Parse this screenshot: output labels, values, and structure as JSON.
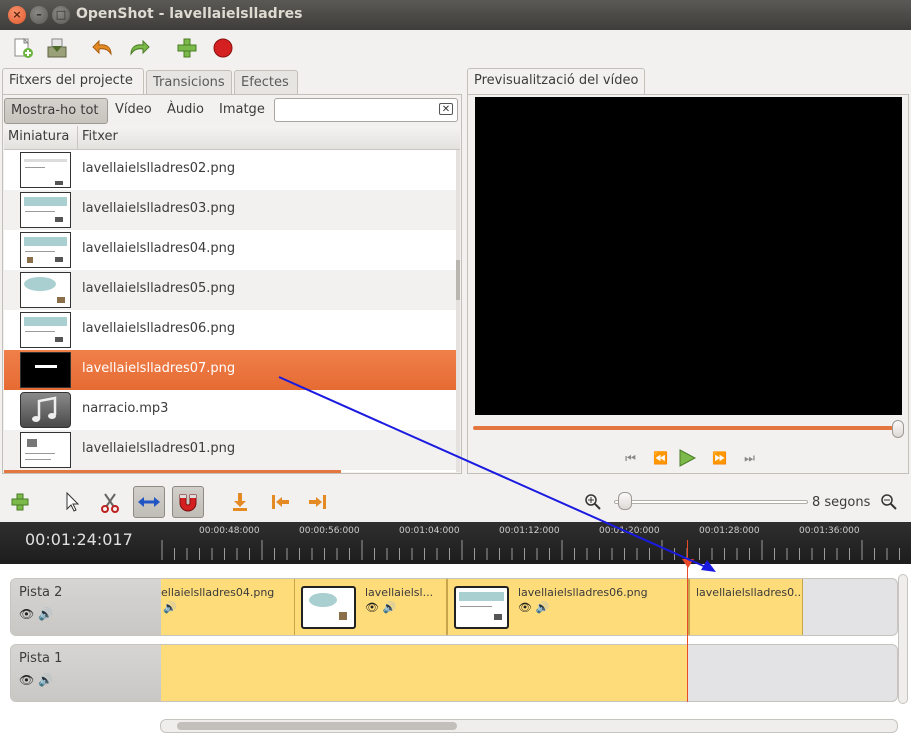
{
  "window": {
    "title": "OpenShot - lavellaielslladres"
  },
  "toolbar": {
    "new_icon": "new-project-icon",
    "save_icon": "save-project-icon",
    "undo_icon": "undo-arrow-icon",
    "redo_icon": "redo-arrow-icon",
    "import_icon": "add-files-icon",
    "export_icon": "export-video-icon"
  },
  "left_tabs": [
    "Fitxers del projecte",
    "Transicions",
    "Efectes"
  ],
  "filters": {
    "all": "Mostra-ho tot",
    "video": "Vídeo",
    "audio": "Àudio",
    "image": "Imatge",
    "search_value": ""
  },
  "file_table": {
    "headers": [
      "Miniatura",
      "Fitxer"
    ],
    "rows": [
      {
        "name": "lavellaielslladres02.png"
      },
      {
        "name": "lavellaielslladres03.png"
      },
      {
        "name": "lavellaielslladres04.png"
      },
      {
        "name": "lavellaielslladres05.png"
      },
      {
        "name": "lavellaielslladres06.png"
      },
      {
        "name": "lavellaielslladres07.png"
      },
      {
        "name": "narracio.mp3"
      },
      {
        "name": "lavellaielslladres01.png"
      }
    ],
    "selected_index": 5
  },
  "preview": {
    "tab": "Previsualització del vídeo",
    "progress": 1.0
  },
  "timeline_toolbar": {
    "zoom_label": "8 segons",
    "zoom_level": 0.03
  },
  "timeline": {
    "current_time": "00:01:24:017",
    "ticks": [
      "00:00:48:000",
      "00:00:56:000",
      "00:01:04:000",
      "00:01:12:000",
      "00:01:20:000",
      "00:01:28:000",
      "00:01:36:000"
    ],
    "tracks": [
      {
        "name": "Pista 2",
        "clips": [
          {
            "name": "ellaielslladres04.png"
          },
          {
            "name": "lavellaielsl..."
          },
          {
            "name": "lavellaielslladres06.png"
          },
          {
            "name": "lavellaielslladres0..."
          }
        ]
      },
      {
        "name": "Pista 1",
        "clips": []
      }
    ]
  },
  "colors": {
    "accent": "#e66b33",
    "clip": "#fedc79",
    "playhead": "#e84a2a",
    "arrow": "#1a1ae0"
  }
}
